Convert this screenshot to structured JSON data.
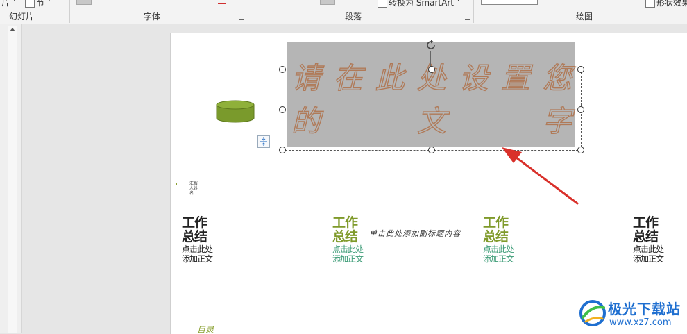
{
  "ribbon": {
    "frag_left": "片",
    "frag_section": "节",
    "frag_smartart": "转换为 SmartArt",
    "frag_shape_effects": "形状效果",
    "groups": {
      "slides": "幻灯片",
      "font": "字体",
      "paragraph": "段落",
      "drawing": "绘图"
    },
    "icons": [
      "section-icon",
      "dropdown-arrow-icon",
      "smartart-icon",
      "shape-effects-icon",
      "dialog-launcher-icon"
    ]
  },
  "slide": {
    "wordart_line1": [
      "请",
      "在",
      "此",
      "处",
      "设",
      "置",
      "您"
    ],
    "wordart_line2": [
      "的",
      "文",
      "字"
    ],
    "cards": [
      {
        "title_line1": "工作",
        "title_line2": "总结",
        "sub_line1": "点击此处",
        "sub_line2": "添加正文",
        "variant": "dark"
      },
      {
        "title_line1": "工作",
        "title_line2": "总结",
        "sub_line1": "点击此处",
        "sub_line2": "添加正文",
        "variant": "green"
      },
      {
        "title_line1": "工作",
        "title_line2": "总结",
        "sub_line1": "点击此处",
        "sub_line2": "添加正文",
        "variant": "green"
      },
      {
        "title_line1": "工作",
        "title_line2": "总结",
        "sub_line1": "点击此处",
        "sub_line2": "添加正文",
        "variant": "dark"
      }
    ],
    "subtitle": "单击此处添加副标题内容",
    "tiny_text": "汇报人姓名",
    "catalog": "目录",
    "colors": {
      "wordart_fill": "#b5b5b5",
      "wordart_stroke": "#b07a58",
      "accent_green": "#7f9a2a",
      "text_teal": "#3d9c77",
      "arrow_red": "#d9302a"
    }
  },
  "watermark": {
    "name": "极光下载站",
    "url": "www.xz7.com"
  }
}
